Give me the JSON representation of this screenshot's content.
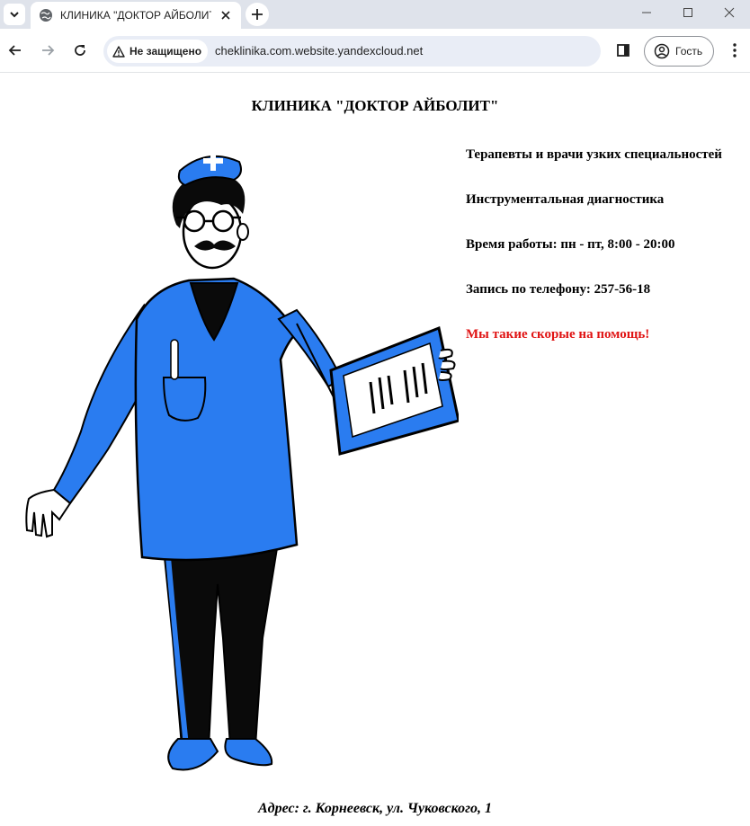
{
  "browser": {
    "tab_title": "КЛИНИКА \"ДОКТОР АЙБОЛИТ\"",
    "security_label": "Не защищено",
    "url": "cheklinika.com.website.yandexcloud.net",
    "profile_label": "Гость"
  },
  "page": {
    "title": "КЛИНИКА \"ДОКТОР АЙБОЛИТ\"",
    "info": [
      "Терапевты и врачи узких специальностей",
      "Инструментальная диагностика",
      "Время работы: пн - пт, 8:00 - 20:00",
      "Запись по телефону: 257-56-18"
    ],
    "slogan": "Мы такие скорые на помощь!",
    "address": "Адрес: г. Корнеевск, ул. Чуковского, 1"
  },
  "colors": {
    "accent_blue": "#2a7cf0",
    "slogan_red": "#e01414"
  }
}
